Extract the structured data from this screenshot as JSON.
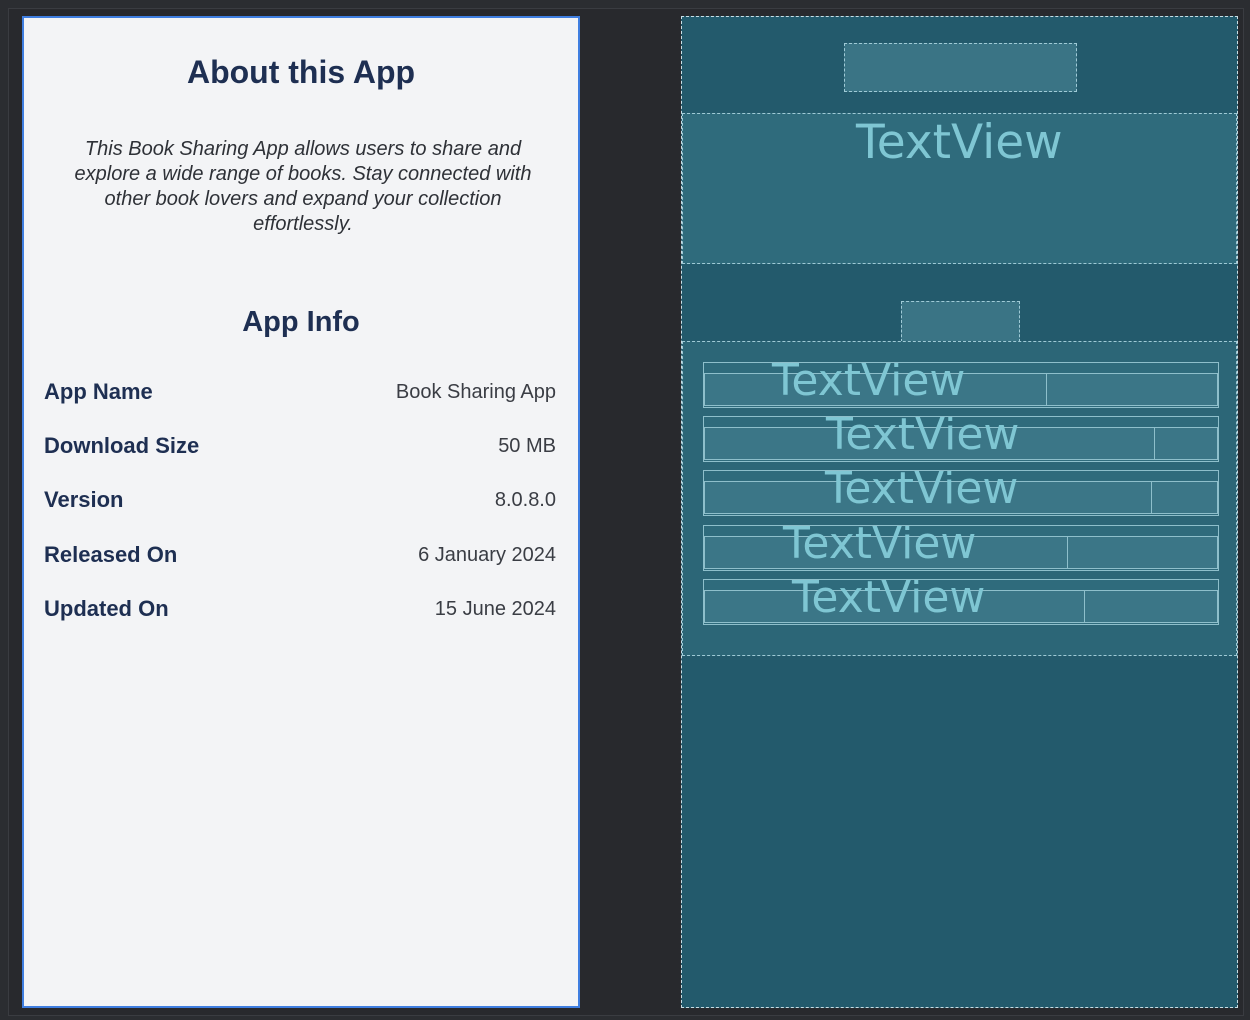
{
  "about": {
    "title": "About this App",
    "description": "This Book Sharing App allows users to share and explore a wide range of books. Stay connected with other book lovers and expand your collection effortlessly."
  },
  "app_info": {
    "title": "App Info",
    "rows": [
      {
        "label": "App Name",
        "value": "Book Sharing App"
      },
      {
        "label": "Download Size",
        "value": "50 MB"
      },
      {
        "label": "Version",
        "value": "8.0.8.0"
      },
      {
        "label": "Released On",
        "value": "6 January 2024"
      },
      {
        "label": "Updated On",
        "value": "15 June 2024"
      }
    ]
  },
  "blueprint": {
    "placeholder": "TextView",
    "rows": [
      "TextView",
      "TextView",
      "TextView",
      "TextView",
      "TextView"
    ]
  },
  "colors": {
    "title": "#1e2f52",
    "blueprint_bg": "#235a6c",
    "blueprint_text": "#7fc6d3",
    "selection": "#3f7ee0"
  }
}
